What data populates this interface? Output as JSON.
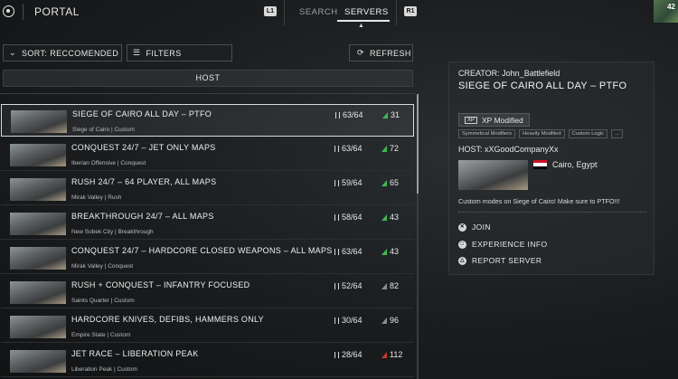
{
  "topbar": {
    "title": "PORTAL",
    "l1_label": "L1",
    "r1_label": "R1",
    "tabs": [
      "SEARCH",
      "SERVERS"
    ],
    "active_tab": "SERVERS",
    "avatar_level": "42"
  },
  "controls": {
    "sort_label": "SORT: RECCOMENDED",
    "filters_label": "FILTERS",
    "refresh_label": "REFRESH",
    "host_label": "HOST"
  },
  "servers": [
    {
      "name": "SIEGE OF CAIRO ALL DAY – PTFO",
      "sub": "Siege of Cairo | Custom",
      "players": "63/64",
      "ping": "31",
      "ping_color": "#3fb950",
      "selected": true
    },
    {
      "name": "CONQUEST 24/7 – JET ONLY MAPS",
      "sub": "Iberian Offensive | Conquest",
      "players": "63/64",
      "ping": "72",
      "ping_color": "#3fb950",
      "selected": false
    },
    {
      "name": "RUSH 24/7 – 64  PLAYER, ALL MAPS",
      "sub": "Mirak Valley | Rush",
      "players": "59/64",
      "ping": "65",
      "ping_color": "#3fb950",
      "selected": false
    },
    {
      "name": "BREAKTHROUGH 24/7 – ALL MAPS",
      "sub": "New Sobek City | Breakthrough",
      "players": "58/64",
      "ping": "43",
      "ping_color": "#3fb950",
      "selected": false
    },
    {
      "name": "CONQUEST 24/7 – HARDCORE CLOSED WEAPONS – ALL MAPS",
      "sub": "Mirak Valley | Conquest",
      "players": "63/64",
      "ping": "43",
      "ping_color": "#3fb950",
      "selected": false
    },
    {
      "name": "RUSH + CONQUEST – INFANTRY FOCUSED",
      "sub": "Saints Quarter | Custom",
      "players": "52/64",
      "ping": "82",
      "ping_color": "#8a8d8f",
      "selected": false
    },
    {
      "name": "HARDCORE KNIVES, DEFIBS, HAMMERS ONLY",
      "sub": "Empire State | Custom",
      "players": "30/64",
      "ping": "96",
      "ping_color": "#8a8d8f",
      "selected": false
    },
    {
      "name": "JET RACE – LIBERATION PEAK",
      "sub": "Liberation Peak | Custom",
      "players": "28/64",
      "ping": "112",
      "ping_color": "#c0392b",
      "selected": false
    }
  ],
  "detail": {
    "creator": "CREATOR:  John_Battlefield",
    "title": "SIEGE OF CAIRO ALL DAY – PTFO",
    "xp_icon": "XP",
    "xp_label": "XP Modified",
    "tags": [
      "Symmetical Modifiers",
      "Heavily Modified",
      "Custom Logic",
      "..."
    ],
    "host": "HOST:  xXGoodCompanyXx",
    "location": "Cairo, Egypt",
    "description": "Custom modes on Siege of Cairo! Make sure to PTFO!!!",
    "actions": [
      {
        "label": "JOIN",
        "icon": "✕"
      },
      {
        "label": "EXPERIENCE INFO",
        "icon": "□"
      },
      {
        "label": "REPORT SERVER",
        "icon": "△"
      }
    ]
  }
}
